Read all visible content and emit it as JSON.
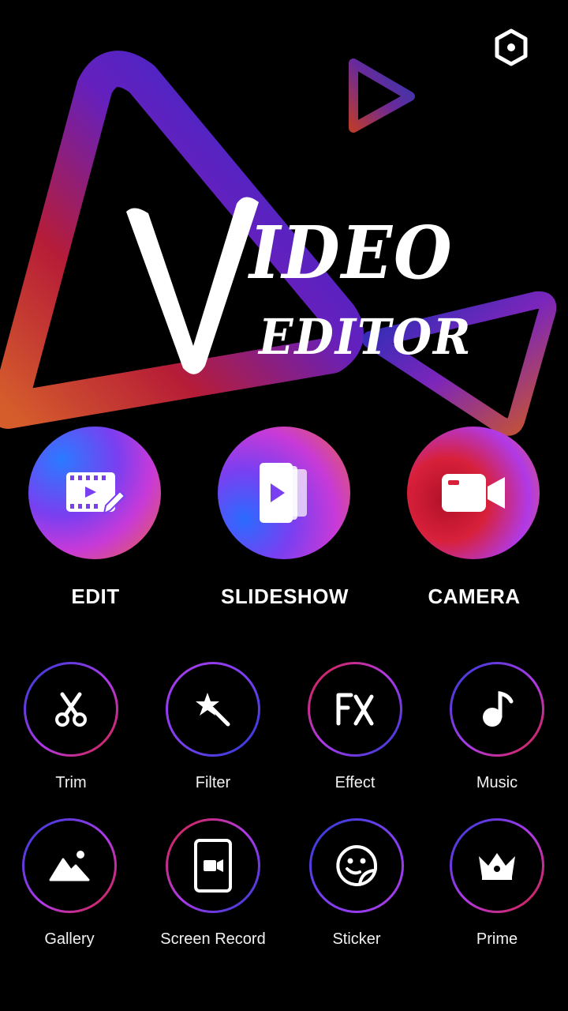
{
  "logo": {
    "word1": "IDEO",
    "word2": "EDITOR"
  },
  "main_actions": [
    {
      "label": "EDIT",
      "icon": "film-edit-icon"
    },
    {
      "label": "SLIDESHOW",
      "icon": "slideshow-icon"
    },
    {
      "label": "CAMERA",
      "icon": "video-camera-icon"
    }
  ],
  "tools_row1": [
    {
      "label": "Trim",
      "icon": "scissors-icon"
    },
    {
      "label": "Filter",
      "icon": "magic-wand-icon"
    },
    {
      "label": "Effect",
      "icon": "fx-icon"
    },
    {
      "label": "Music",
      "icon": "music-note-icon"
    }
  ],
  "tools_row2": [
    {
      "label": "Gallery",
      "icon": "image-icon"
    },
    {
      "label": "Screen Record",
      "icon": "screen-record-icon"
    },
    {
      "label": "Sticker",
      "icon": "sticker-icon"
    },
    {
      "label": "Prime",
      "icon": "crown-icon"
    }
  ],
  "colors": {
    "background": "#000000",
    "accent_blue": "#2a3bd6",
    "accent_purple": "#b03ae8",
    "accent_red": "#d8203a",
    "accent_orange": "#e8643a"
  }
}
